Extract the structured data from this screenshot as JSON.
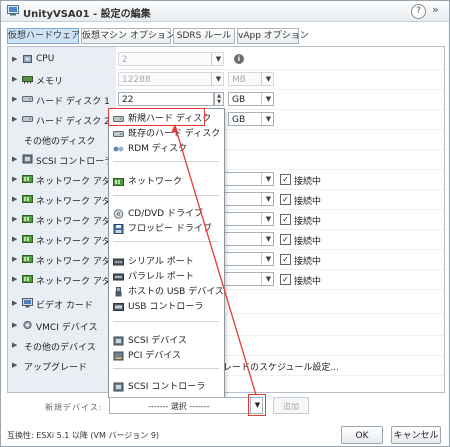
{
  "window": {
    "title": "UnityVSA01 - 設定の編集",
    "help_icon": "?",
    "more_icon": "»"
  },
  "tabs": [
    "仮想ハードウェア",
    "仮想マシン オプション",
    "SDRS ルール",
    "vApp オプション"
  ],
  "rows": {
    "cpu": {
      "label": "CPU",
      "value": "2"
    },
    "memory": {
      "label": "メモリ",
      "value": "12288",
      "unit": "MB"
    },
    "disk1": {
      "label": "ハード ディスク 1",
      "value": "22",
      "unit": "GB"
    },
    "disk2": {
      "label": "ハード ディスク 2",
      "unit": "GB"
    },
    "other_disk": {
      "label": "その他のディスク"
    },
    "scsi": {
      "label": "SCSI コントローラ 0"
    },
    "net": {
      "label": "ネットワーク アダプタ",
      "connected": "接続中"
    },
    "video": {
      "label": "ビデオ カード"
    },
    "vmci": {
      "label": "VMCI デバイス"
    },
    "other_dev": {
      "label": "その他のデバイス"
    },
    "upgrade": {
      "label": "アップグレード",
      "text": "グレードのスケジュール設定..."
    }
  },
  "menu": [
    {
      "label": "新規ハード ディスク"
    },
    {
      "label": "既存のハード ディスク"
    },
    {
      "label": "RDM ディスク"
    },
    {
      "label": "ネットワーク"
    },
    {
      "label": "CD/DVD ドライブ"
    },
    {
      "label": "フロッピー ドライブ"
    },
    {
      "label": "シリアル ポート"
    },
    {
      "label": "パラレル ポート"
    },
    {
      "label": "ホストの USB デバイス"
    },
    {
      "label": "USB コントローラ"
    },
    {
      "label": "SCSI デバイス"
    },
    {
      "label": "PCI デバイス"
    },
    {
      "label": "SCSI コントローラ"
    }
  ],
  "bottom": {
    "new_device_label": "新規デバイス:",
    "select_value": "------- 選択 -------",
    "add_button": "追加",
    "compat": "互換性: ESXi 5.1 以降 (VM バージョン 9)",
    "ok": "OK",
    "cancel": "キャンセル"
  },
  "colors": {
    "highlight": "#e53935",
    "tab_active": "#cfe3f6"
  }
}
